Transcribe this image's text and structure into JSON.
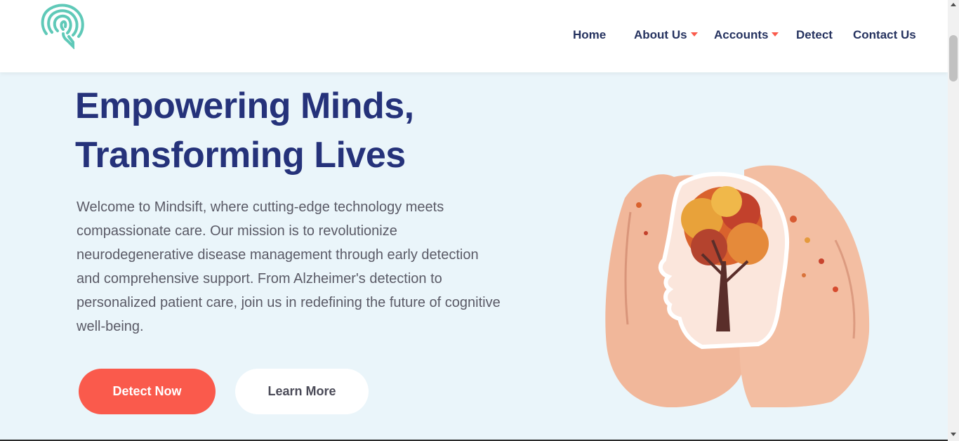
{
  "brand": {
    "logo_icon": "fingerprint-brain-icon",
    "logo_color": "#5fc9b8"
  },
  "nav": {
    "items": [
      {
        "label": "Home",
        "dropdown": false
      },
      {
        "label": "About Us",
        "dropdown": true
      },
      {
        "label": "Accounts",
        "dropdown": true
      },
      {
        "label": "Detect",
        "dropdown": false
      },
      {
        "label": "Contact Us",
        "dropdown": false
      }
    ]
  },
  "hero": {
    "title_line1": "Empowering Minds,",
    "title_line2": "Transforming Lives",
    "description": "Welcome to Mindsift, where cutting-edge technology meets compassionate care. Our mission is to revolutionize neurodegenerative disease management through early detection and comprehensive support. From Alzheimer's detection to personalized patient care, join us in redefining the future of cognitive well-being.",
    "primary_button": "Detect Now",
    "secondary_button": "Learn More",
    "image_subject": "hands-holding-head-with-autumn-tree"
  },
  "colors": {
    "nav_text": "#25325f",
    "title": "#25327a",
    "accent": "#fa5a4c",
    "background": "#eaf5fa",
    "body_text": "#5a5a66"
  }
}
